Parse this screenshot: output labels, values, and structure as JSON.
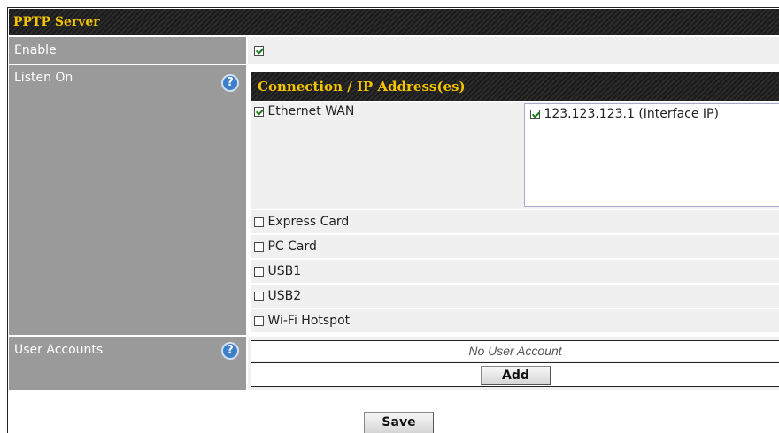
{
  "section": {
    "title": "PPTP Server"
  },
  "enable": {
    "label": "Enable",
    "checked": true
  },
  "listen_on": {
    "label": "Listen On",
    "help_icon": "question-circle-icon",
    "table_header": "Connection / IP Address(es)",
    "connections": [
      {
        "name": "Ethernet WAN",
        "checked": true,
        "addresses": [
          {
            "label": "123.123.123.1 (Interface IP)",
            "checked": true
          }
        ]
      },
      {
        "name": "Express Card",
        "checked": false
      },
      {
        "name": "PC Card",
        "checked": false
      },
      {
        "name": "USB1",
        "checked": false
      },
      {
        "name": "USB2",
        "checked": false
      },
      {
        "name": "Wi-Fi Hotspot",
        "checked": false
      }
    ]
  },
  "user_accounts": {
    "label": "User Accounts",
    "help_icon": "question-circle-icon",
    "empty_text": "No User Account",
    "add_label": "Add"
  },
  "save_label": "Save",
  "colors": {
    "header_bg": "#1b1b1b",
    "header_text": "#f5c400",
    "label_bg": "#9a9a9a",
    "help_icon": "#3e7fcb"
  }
}
